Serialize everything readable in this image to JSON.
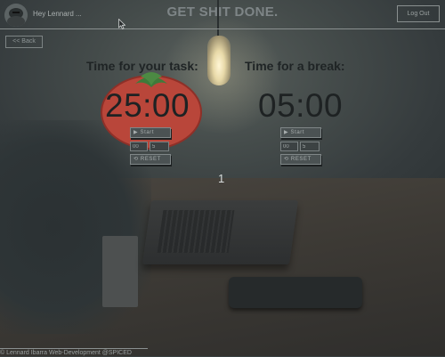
{
  "header": {
    "greeting": "Hey Lennard ...",
    "title": "GET SHIT DONE.",
    "logout_label": "Log Out"
  },
  "nav": {
    "back_label": "<< Back"
  },
  "task_timer": {
    "title": "Time for your task:",
    "display": "25:00",
    "start_label": "▶ Start",
    "minutes_value": "00",
    "seconds_value": "5",
    "reset_label": "⟲ RESET"
  },
  "break_timer": {
    "title": "Time for a break:",
    "display": "05:00",
    "start_label": "▶ Start",
    "minutes_value": "00",
    "seconds_value": "5",
    "reset_label": "⟲ RESET"
  },
  "session_counter": "1",
  "footer": {
    "credit": "© Lennard Ibarra Web-Development @SPICED"
  },
  "icons": {
    "avatar": "avatar-icon",
    "tomato": "tomato-icon",
    "cursor": "mouse-cursor-icon"
  },
  "colors": {
    "tomato_red": "#c0453a",
    "tomato_leaf": "#3f7a3a",
    "title_text": "#7e8587"
  }
}
